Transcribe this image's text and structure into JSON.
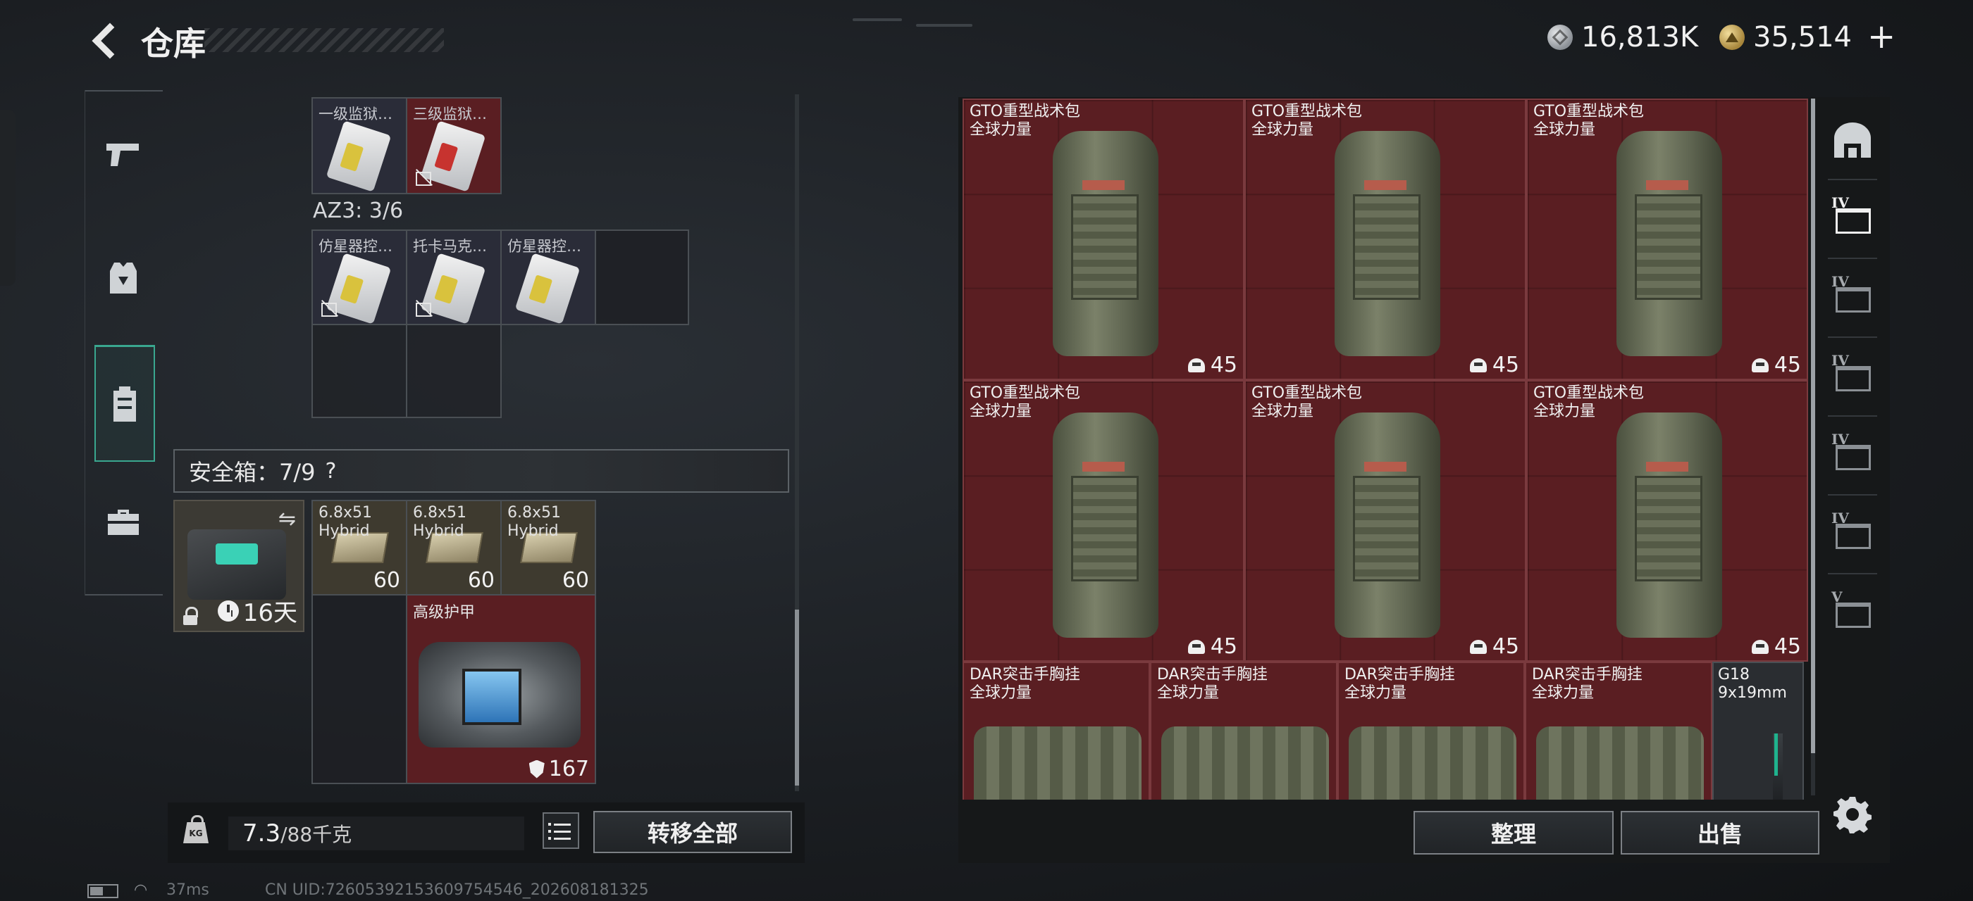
{
  "header": {
    "title": "仓库",
    "currency_silver": "16,813K",
    "currency_gold": "35,514",
    "add_label": "+"
  },
  "colors": {
    "accent_teal": "#3aa78f",
    "item_red": "#5a1e22",
    "background": "#1b1e22"
  },
  "left_tabs": [
    {
      "name": "weapons",
      "icon": "pistol-icon"
    },
    {
      "name": "armor-vest",
      "icon": "vest-icon"
    },
    {
      "name": "backpack",
      "icon": "backpack-icon",
      "active": true
    },
    {
      "name": "toolbox",
      "icon": "toolbox-icon"
    }
  ],
  "keys_top": [
    {
      "name": "一级监狱…",
      "type": "keycard",
      "chip": "yellow"
    },
    {
      "name": "三级监狱…",
      "type": "keycard",
      "chip": "red",
      "no_sell": true
    }
  ],
  "az3": {
    "label": "AZ3: 3/6",
    "items": [
      {
        "name": "仿星器控…",
        "no_sell": true
      },
      {
        "name": "托卡马克…",
        "no_sell": true
      },
      {
        "name": "仿星器控…",
        "no_sell": false
      }
    ]
  },
  "safebox": {
    "label": "安全箱：7/9",
    "help": "?",
    "timer": "16天",
    "ammo": [
      {
        "line1": "6.8x51",
        "line2": "Hybrid",
        "count": "60"
      },
      {
        "line1": "6.8x51",
        "line2": "Hybrid",
        "count": "60"
      },
      {
        "line1": "6.8x51",
        "line2": "Hybrid",
        "count": "60"
      }
    ],
    "armor": {
      "name": "高级护甲",
      "durability": "167"
    }
  },
  "weight": {
    "current": "7.3",
    "max": "/88千克"
  },
  "buttons": {
    "transfer_all": "转移全部",
    "organize": "整理",
    "sell": "出售"
  },
  "stash_bags": [
    {
      "line1": "GTO重型战术包",
      "line2": "全球力量",
      "count": "45"
    },
    {
      "line1": "GTO重型战术包",
      "line2": "全球力量",
      "count": "45"
    },
    {
      "line1": "GTO重型战术包",
      "line2": "全球力量",
      "count": "45"
    },
    {
      "line1": "GTO重型战术包",
      "line2": "全球力量",
      "count": "45"
    },
    {
      "line1": "GTO重型战术包",
      "line2": "全球力量",
      "count": "45"
    },
    {
      "line1": "GTO重型战术包",
      "line2": "全球力量",
      "count": "45"
    }
  ],
  "stash_rigs": [
    {
      "line1": "DAR突击手胸挂",
      "line2": "全球力量"
    },
    {
      "line1": "DAR突击手胸挂",
      "line2": "全球力量"
    },
    {
      "line1": "DAR突击手胸挂",
      "line2": "全球力量"
    },
    {
      "line1": "DAR突击手胸挂",
      "line2": "全球力量"
    }
  ],
  "stash_pistol": {
    "line1": "G18",
    "line2": "9x19mm"
  },
  "right_tabs": [
    {
      "icon": "stash-icon",
      "level": ""
    },
    {
      "icon": "stash-iv-icon",
      "level": "IV",
      "active": true
    },
    {
      "icon": "stash-iv-icon",
      "level": "IV"
    },
    {
      "icon": "stash-iv-icon",
      "level": "IV"
    },
    {
      "icon": "stash-iv-icon",
      "level": "IV"
    },
    {
      "icon": "stash-iv-add-icon",
      "level": "IV"
    },
    {
      "icon": "stash-v-icon",
      "level": "V"
    }
  ],
  "status": {
    "ping": "37ms",
    "uid": "CN UID:72605392153609754546_202608181325"
  }
}
